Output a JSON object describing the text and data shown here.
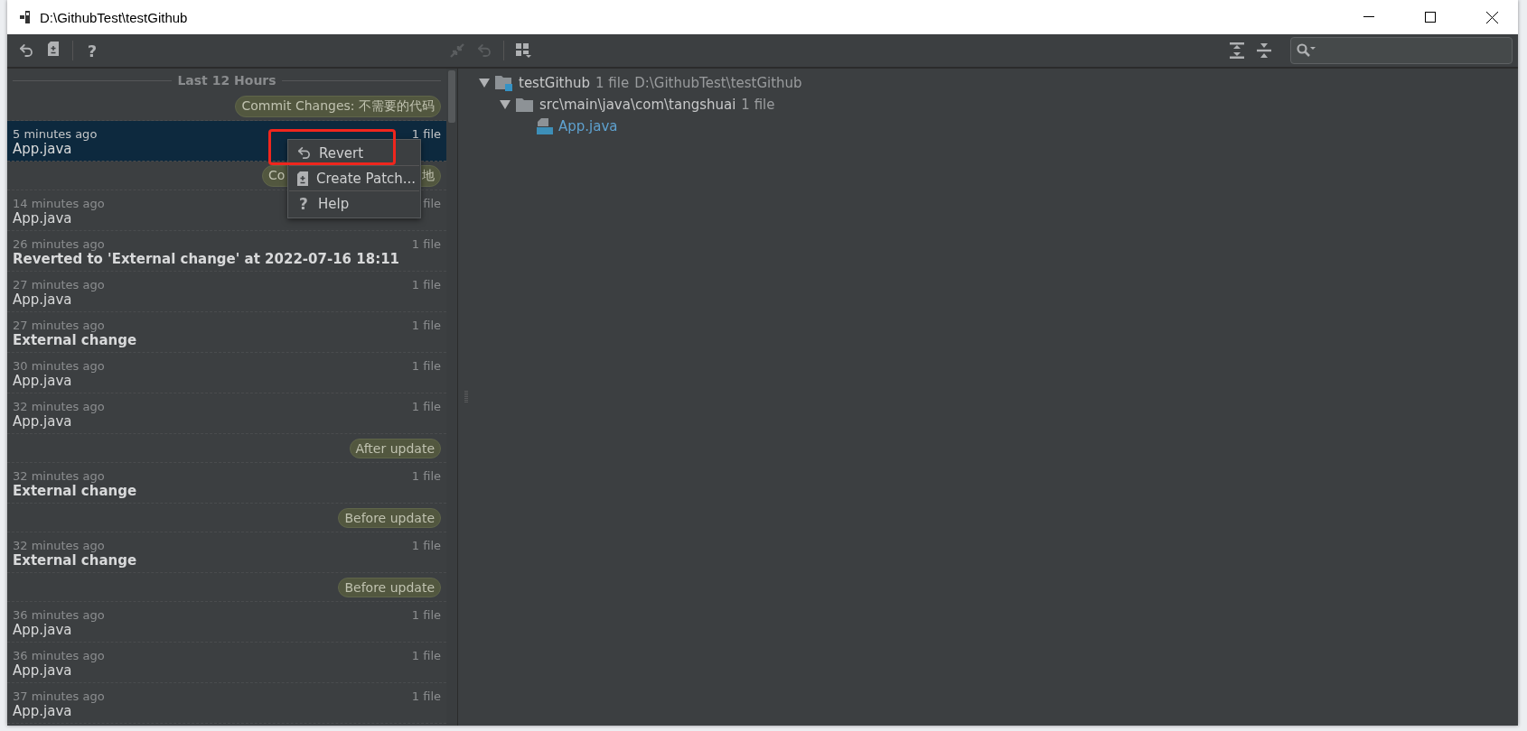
{
  "window": {
    "title": "D:\\GithubTest\\testGithub"
  },
  "toolbar_left": [
    {
      "kind": "revert",
      "disabled": false
    },
    {
      "kind": "patch",
      "disabled": false
    },
    {
      "kind": "help",
      "glyph": "?",
      "disabled": false
    }
  ],
  "toolbar_middle": [
    {
      "kind": "compare",
      "disabled": true
    },
    {
      "kind": "revert",
      "disabled": true
    },
    {
      "kind": "group",
      "disabled": false
    }
  ],
  "toolbar_right": [
    {
      "kind": "expand-all",
      "disabled": false
    },
    {
      "kind": "collapse-all",
      "disabled": false
    }
  ],
  "history": {
    "group_header": "Last 12 Hours",
    "rows": [
      {
        "kind": "label",
        "text": "Commit Changes: 不需要的代码"
      },
      {
        "kind": "revision",
        "time": "5 minutes ago",
        "title": "App.java",
        "count": "1 file",
        "bold": false,
        "selected": true
      },
      {
        "kind": "label",
        "text": "Co",
        "text_end": "地"
      },
      {
        "kind": "revision",
        "time": "14 minutes ago",
        "title": "App.java",
        "count": "file",
        "bold": false,
        "selected": false
      },
      {
        "kind": "revision",
        "time": "26 minutes ago",
        "title": "Reverted to 'External change' at 2022-07-16 18:11",
        "count": "1 file",
        "bold": true,
        "selected": false
      },
      {
        "kind": "revision",
        "time": "27 minutes ago",
        "title": "App.java",
        "count": "1 file",
        "bold": false,
        "selected": false
      },
      {
        "kind": "revision",
        "time": "27 minutes ago",
        "title": "External change",
        "count": "1 file",
        "bold": true,
        "selected": false
      },
      {
        "kind": "revision",
        "time": "30 minutes ago",
        "title": "App.java",
        "count": "1 file",
        "bold": false,
        "selected": false
      },
      {
        "kind": "revision",
        "time": "32 minutes ago",
        "title": "App.java",
        "count": "1 file",
        "bold": false,
        "selected": false
      },
      {
        "kind": "label",
        "text": "After update"
      },
      {
        "kind": "revision",
        "time": "32 minutes ago",
        "title": "External change",
        "count": "1 file",
        "bold": true,
        "selected": false
      },
      {
        "kind": "label",
        "text": "Before update"
      },
      {
        "kind": "revision",
        "time": "32 minutes ago",
        "title": "External change",
        "count": "1 file",
        "bold": true,
        "selected": false
      },
      {
        "kind": "label",
        "text": "Before update"
      },
      {
        "kind": "revision",
        "time": "36 minutes ago",
        "title": "App.java",
        "count": "1 file",
        "bold": false,
        "selected": false
      },
      {
        "kind": "revision",
        "time": "36 minutes ago",
        "title": "App.java",
        "count": "1 file",
        "bold": false,
        "selected": false
      },
      {
        "kind": "revision",
        "time": "37 minutes ago",
        "title": "App.java",
        "count": "1 file",
        "bold": false,
        "selected": false
      }
    ]
  },
  "context_menu": {
    "items": [
      {
        "kind": "revert",
        "label": "Revert",
        "highlighted": true
      },
      {
        "kind": "patch",
        "label": "Create Patch...",
        "highlighted": false
      },
      {
        "kind": "help",
        "glyph": "?",
        "label": "Help",
        "highlighted": false
      }
    ]
  },
  "tree": [
    {
      "kind": "module",
      "name": "testGithub",
      "count": "1 file",
      "path": "D:\\GithubTest\\testGithub",
      "expanded": true,
      "children": [
        {
          "kind": "folder",
          "name": "src\\main\\java\\com\\tangshuai",
          "count": "1 file",
          "expanded": true,
          "children": [
            {
              "kind": "file",
              "name": "App.java"
            }
          ]
        }
      ]
    }
  ]
}
